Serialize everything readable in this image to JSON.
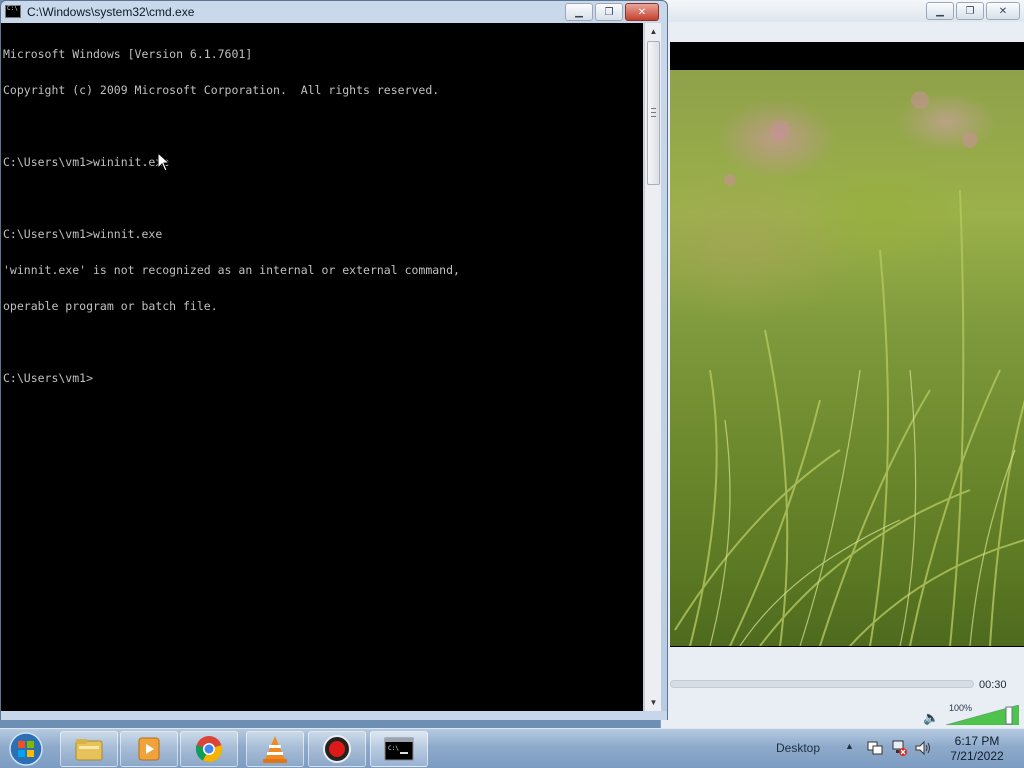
{
  "cmd_window": {
    "title": "C:\\Windows\\system32\\cmd.exe",
    "console_lines": [
      "Microsoft Windows [Version 6.1.7601]",
      "Copyright (c) 2009 Microsoft Corporation.  All rights reserved.",
      "",
      "C:\\Users\\vm1>wininit.exe",
      "",
      "C:\\Users\\vm1>winnit.exe",
      "'winnit.exe' is not recognized as an internal or external command,",
      "operable program or batch file.",
      "",
      "C:\\Users\\vm1>"
    ]
  },
  "media_player": {
    "elapsed_time": "00:30",
    "volume_percent_label": "100%",
    "volume_level": 1.0
  },
  "taskbar": {
    "start_icon": "windows-orb-icon",
    "pinned": [
      {
        "name": "explorer",
        "icon": "folder-icon"
      },
      {
        "name": "media-player",
        "icon": "windows-media-player-icon"
      },
      {
        "name": "chrome",
        "icon": "chrome-icon"
      },
      {
        "name": "vlc",
        "icon": "vlc-cone-icon"
      },
      {
        "name": "recorder",
        "icon": "record-icon"
      },
      {
        "name": "cmd",
        "icon": "cmd-icon",
        "active": true
      }
    ],
    "show_desktop_label": "Desktop",
    "clock_time": "6:17 PM",
    "clock_date": "7/21/2022"
  },
  "colors": {
    "console_bg": "#000000",
    "console_text": "#c0c0c0",
    "close_button": "#c4412e",
    "taskbar": "#8eaacb"
  }
}
